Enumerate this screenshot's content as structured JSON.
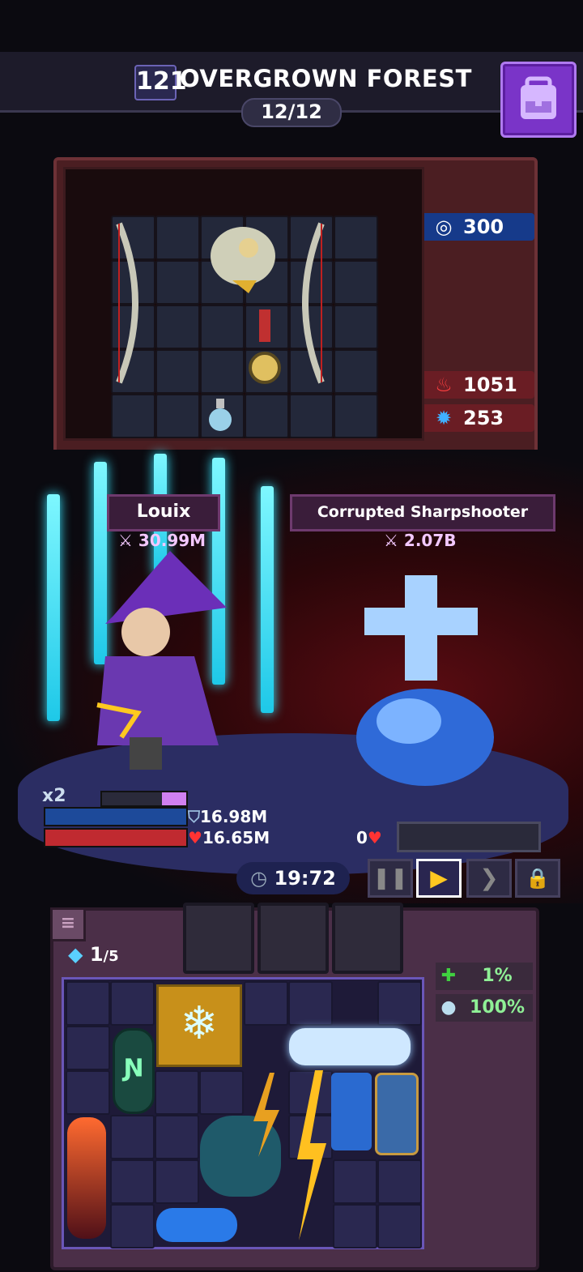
{
  "header": {
    "level": "121",
    "zone_name": "OVERGROWN FOREST",
    "wave": "12/12",
    "backpack_icon": "backpack-icon"
  },
  "enemy_stats": {
    "speed_value": "300",
    "attack_value": "1051",
    "defense_value": "253"
  },
  "player": {
    "name": "Louix",
    "power": "30.99M",
    "multiplier": "x2",
    "shield": "16.98M",
    "health": "16.65M"
  },
  "enemy": {
    "name": "Corrupted Sharpshooter",
    "power": "2.07B",
    "health": "0"
  },
  "battle": {
    "timer": "19:72"
  },
  "inventory": {
    "gems": "1",
    "gems_max": "/5",
    "heal_pct": "1%",
    "orb_pct": "100%"
  },
  "colors": {
    "accent_purple": "#7a34c8",
    "sword_cyan": "#38e6ff",
    "enemy_red": "#5a0c12"
  }
}
